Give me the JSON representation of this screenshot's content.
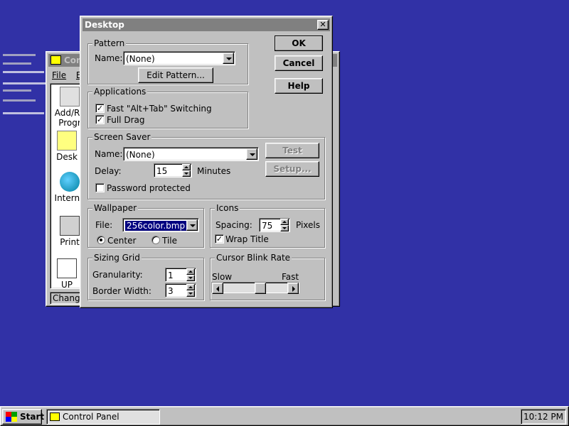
{
  "control_panel": {
    "title": "Con",
    "menu": [
      "File",
      "E"
    ],
    "items": [
      {
        "label": "Add/Re",
        "label2": "Progr",
        "icon": "add-remove-programs-icon"
      },
      {
        "label": "Desk",
        "icon": "desktop-icon"
      },
      {
        "label": "Interna",
        "icon": "internet-icon"
      },
      {
        "label": "Print",
        "icon": "printer-icon"
      },
      {
        "label": "UP",
        "icon": "ups-icon"
      }
    ],
    "status": "Change"
  },
  "dialog": {
    "title": "Desktop",
    "close": "✕",
    "buttons": {
      "ok": "OK",
      "cancel": "Cancel",
      "help": "Help"
    },
    "pattern": {
      "group": "Pattern",
      "name_label": "Name:",
      "name_value": "(None)",
      "edit_button": "Edit Pattern..."
    },
    "applications": {
      "group": "Applications",
      "fast_alt_tab": "Fast \"Alt+Tab\" Switching",
      "fast_alt_tab_checked": true,
      "full_drag": "Full Drag",
      "full_drag_checked": true
    },
    "screen_saver": {
      "group": "Screen Saver",
      "name_label": "Name:",
      "name_value": "(None)",
      "test_button": "Test",
      "setup_button": "Setup...",
      "delay_label": "Delay:",
      "delay_value": "15",
      "delay_unit": "Minutes",
      "password_label": "Password protected",
      "password_checked": false
    },
    "wallpaper": {
      "group": "Wallpaper",
      "file_label": "File:",
      "file_value": "256color.bmp",
      "center_label": "Center",
      "tile_label": "Tile",
      "selected": "Center"
    },
    "icons": {
      "group": "Icons",
      "spacing_label": "Spacing:",
      "spacing_value": "75",
      "spacing_unit": "Pixels",
      "wrap_title": "Wrap Title",
      "wrap_title_checked": true
    },
    "sizing_grid": {
      "group": "Sizing Grid",
      "granularity_label": "Granularity:",
      "granularity_value": "1",
      "border_label": "Border Width:",
      "border_value": "3"
    },
    "cursor_blink": {
      "group": "Cursor Blink Rate",
      "slow_label": "Slow",
      "fast_label": "Fast",
      "level": 0.6
    }
  },
  "taskbar": {
    "start": "Start",
    "task": "Control Panel",
    "clock": "10:12 PM"
  }
}
